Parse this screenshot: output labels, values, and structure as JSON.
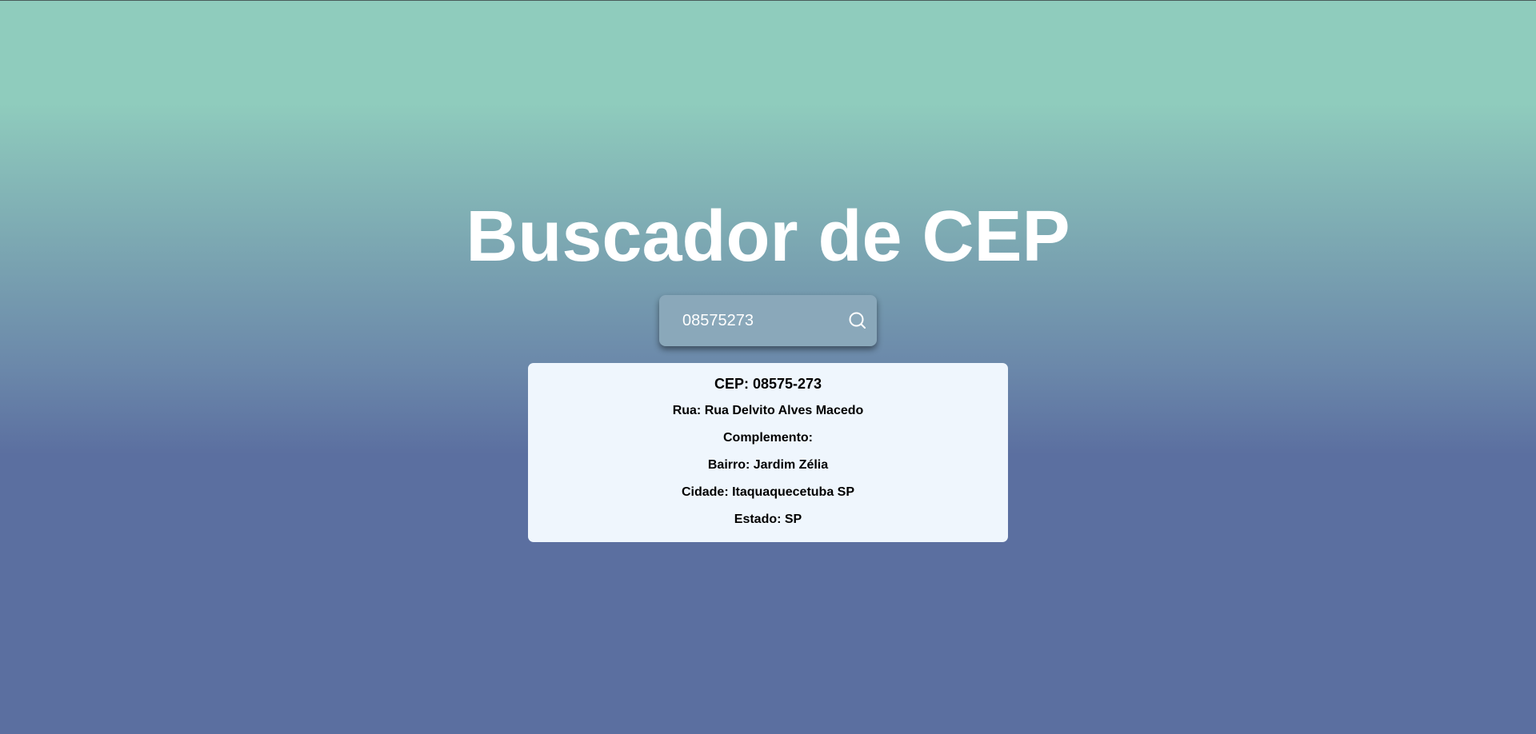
{
  "page": {
    "title": "Buscador de CEP"
  },
  "search": {
    "value": "08575273",
    "placeholder": "",
    "button_icon": "search-icon"
  },
  "result": {
    "cep_label": "CEP: 08575-273",
    "rua_label": "Rua: Rua Delvito Alves Macedo",
    "complemento_label": "Complemento:",
    "bairro_label": "Bairro: Jardim Zélia",
    "cidade_label": "Cidade: Itaquaquecetuba SP",
    "estado_label": "Estado: SP"
  },
  "colors": {
    "gradient_top": "#8fccbd",
    "gradient_bottom": "#5b6fa0",
    "search_bg": "#8aa8ba",
    "card_bg": "#eff6fd",
    "title_color": "#ffffff"
  }
}
